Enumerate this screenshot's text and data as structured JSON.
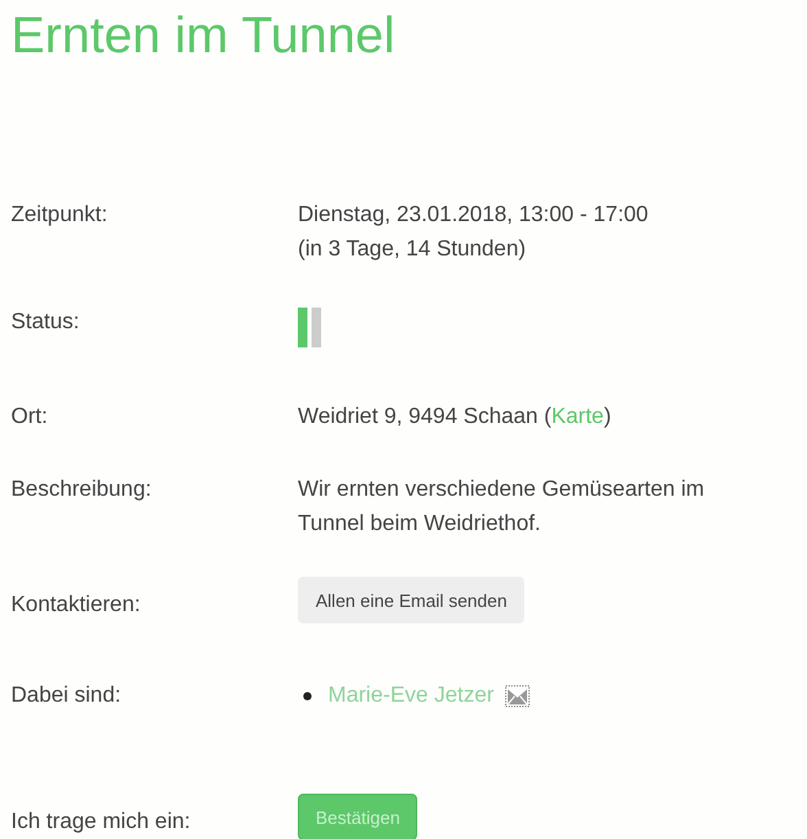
{
  "title": "Ernten im Tunnel",
  "rows": [
    {
      "kind": "text",
      "label": "Zeitpunkt:",
      "lines": [
        "Dienstag, 23.01.2018, 13:00 - 17:00",
        "(in 3 Tage, 14 Stunden)"
      ]
    },
    {
      "kind": "status",
      "label": "Status:",
      "slots": [
        {
          "filled": true
        },
        {
          "filled": false
        }
      ]
    },
    {
      "kind": "place",
      "label": "Ort:",
      "address": "Weidriet 9, 9494 Schaan",
      "open_paren": "(",
      "link": "Karte",
      "close_paren": ")"
    },
    {
      "kind": "text",
      "label": "Beschreibung:",
      "lines": [
        "Wir ernten verschiedene Gemüsearten im",
        "Tunnel beim Weidriethof."
      ]
    },
    {
      "kind": "button",
      "label": "Kontaktieren:",
      "button": "Allen eine Email senden"
    },
    {
      "kind": "people",
      "label": "Dabei sind:",
      "people": [
        "Marie-Eve Jetzer"
      ]
    },
    {
      "kind": "confirm",
      "label": "Ich trage mich ein:",
      "button": "Bestätigen"
    }
  ]
}
